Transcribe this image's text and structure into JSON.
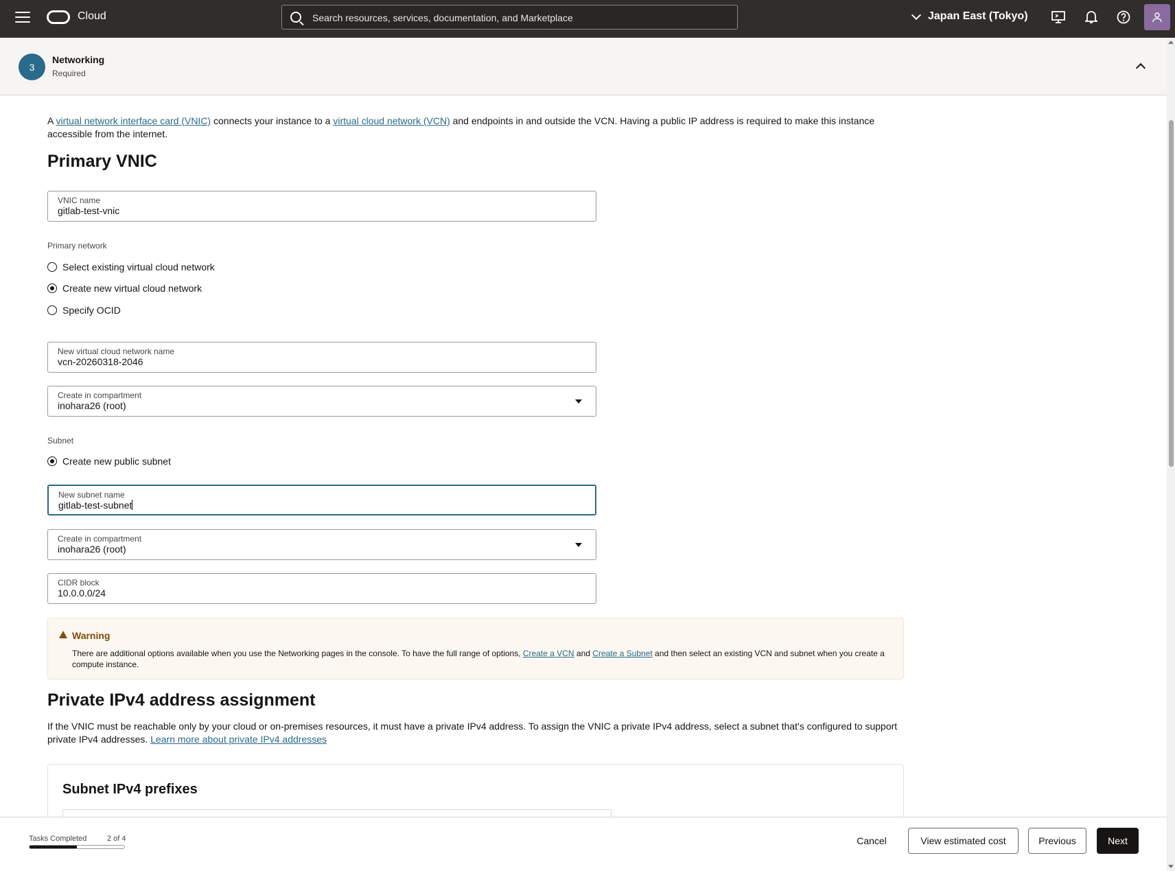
{
  "topbar": {
    "brand": "Cloud",
    "search_placeholder": "Search resources, services, documentation, and Marketplace",
    "region": "Japan East (Tokyo)"
  },
  "section": {
    "step_number": "3",
    "title": "Networking",
    "subtitle": "Required"
  },
  "intro": {
    "prefix": "A ",
    "link_vnic": "virtual network interface card (VNIC)",
    "mid": " connects your instance to a ",
    "link_vcn": "virtual cloud network (VCN)",
    "suffix": " and endpoints in and outside the VCN. Having a public IP address is required to make this instance accessible from the internet."
  },
  "primary_vnic": {
    "heading": "Primary VNIC",
    "vnic_name_label": "VNIC name",
    "vnic_name_value": "gitlab-test-vnic",
    "primary_network_label": "Primary network",
    "network_options": [
      {
        "label": "Select existing virtual cloud network",
        "selected": false
      },
      {
        "label": "Create new virtual cloud network",
        "selected": true
      },
      {
        "label": "Specify OCID",
        "selected": false
      }
    ],
    "vcn_name_label": "New virtual cloud network name",
    "vcn_name_value": "vcn-20260318-2046",
    "vcn_compartment_label": "Create in compartment",
    "vcn_compartment_value": "inohara26 (root)",
    "subnet_label": "Subnet",
    "subnet_option": "Create new public subnet",
    "subnet_name_label": "New subnet name",
    "subnet_name_value": "gitlab-test-subnet",
    "subnet_compartment_label": "Create in compartment",
    "subnet_compartment_value": "inohara26 (root)",
    "cidr_label": "CIDR block",
    "cidr_value": "10.0.0.0/24"
  },
  "warning": {
    "title": "Warning",
    "text_a": "There are additional options available when you use the Networking pages in the console. To have the full range of options, ",
    "link_vcn": "Create a VCN",
    "text_b": " and ",
    "link_subnet": "Create a Subnet",
    "text_c": " and then select an existing VCN and subnet when you create a compute instance."
  },
  "private_ipv4": {
    "heading": "Private IPv4 address assignment",
    "text": "If the VNIC must be reachable only by your cloud or on-premises resources, it must have a private IPv4 address. To assign the VNIC a private IPv4 address, select a subnet that's configured to support private IPv4 addresses. ",
    "link": "Learn more about private IPv4 addresses",
    "card_heading": "Subnet IPv4 prefixes"
  },
  "footer": {
    "tasks_label": "Tasks Completed",
    "tasks_count": "2 of 4",
    "progress_fraction": 0.5,
    "cancel": "Cancel",
    "view_cost": "View estimated cost",
    "previous": "Previous",
    "next": "Next"
  },
  "colors": {
    "topbar": "#312d2a",
    "link": "#2a6a8a",
    "primary_button": "#161513",
    "warning_text": "#7a4f0a"
  }
}
